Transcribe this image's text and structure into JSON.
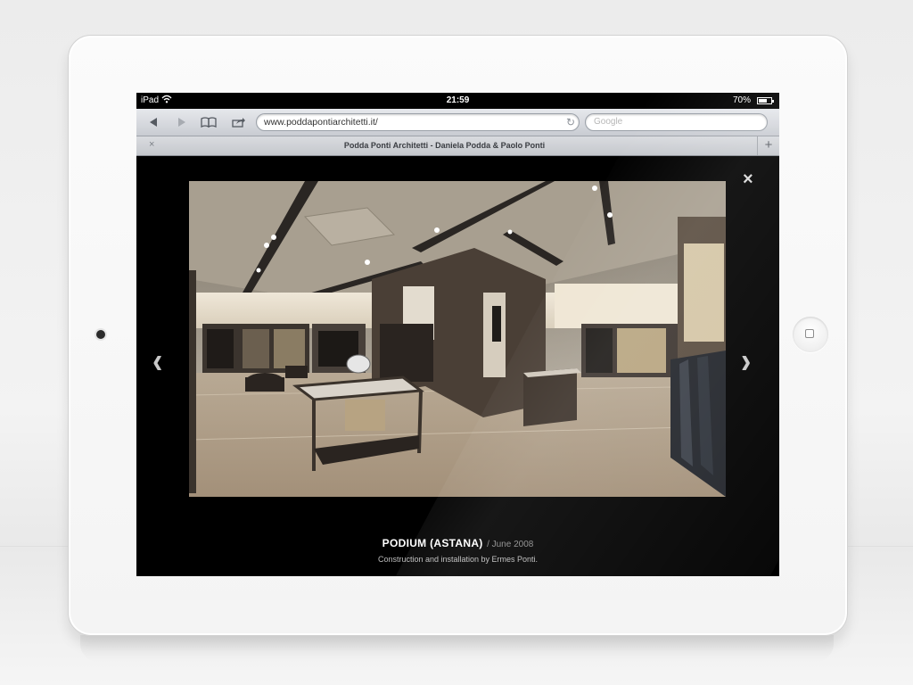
{
  "statusbar": {
    "carrier": "iPad",
    "time": "21:59",
    "battery": "70%",
    "battery_level": 0.7
  },
  "toolbar": {
    "back_icon": "back-arrow-icon",
    "forward_icon": "forward-arrow-icon",
    "bookmarks_icon": "book-icon",
    "share_icon": "share-icon",
    "url": "www.poddapontiarchitetti.it/",
    "search_placeholder": "Google"
  },
  "tab": {
    "title": "Podda Ponti Architetti - Daniela Podda & Paolo Ponti",
    "close": "×",
    "add": "+"
  },
  "gallery": {
    "close_label": "×",
    "prev_label": "‹",
    "next_label": "›",
    "photo_alt": "store interior photo",
    "caption_title": "PODIUM (ASTANA)",
    "caption_date": "/ June 2008",
    "caption_sub": "Construction and installation by Ermes Ponti."
  },
  "colors": {
    "page_background": "#000000",
    "toolbar": "#d5d8dd",
    "device": "#f7f7f7"
  }
}
